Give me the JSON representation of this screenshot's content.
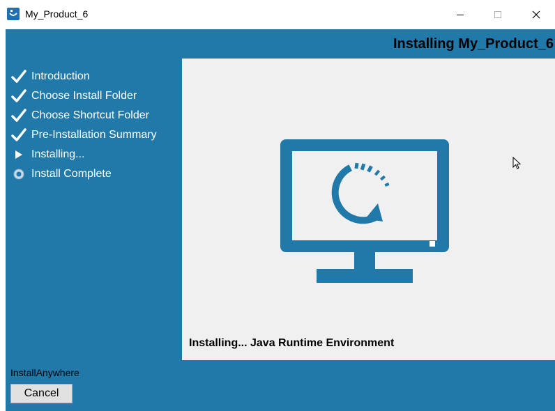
{
  "window": {
    "title": "My_Product_6"
  },
  "header": {
    "title": "Installing My_Product_6"
  },
  "steps": [
    {
      "label": "Introduction",
      "state": "done",
      "icon": "checkmark-icon"
    },
    {
      "label": "Choose Install Folder",
      "state": "done",
      "icon": "checkmark-icon"
    },
    {
      "label": "Choose Shortcut Folder",
      "state": "done",
      "icon": "checkmark-icon"
    },
    {
      "label": "Pre-Installation Summary",
      "state": "done",
      "icon": "checkmark-icon"
    },
    {
      "label": "Installing...",
      "state": "current",
      "icon": "arrow-right-icon"
    },
    {
      "label": "Install Complete",
      "state": "pending",
      "icon": "radio-dot-icon"
    }
  ],
  "main": {
    "status": "Installing... Java Runtime Environment",
    "graphic": "monitor-install-icon"
  },
  "footer": {
    "brand": "InstallAnywhere",
    "cancel_label": "Cancel"
  },
  "colors": {
    "sidebar": "#2079a9",
    "panel": "#f0f0f0",
    "monitor": "#2079a9"
  }
}
